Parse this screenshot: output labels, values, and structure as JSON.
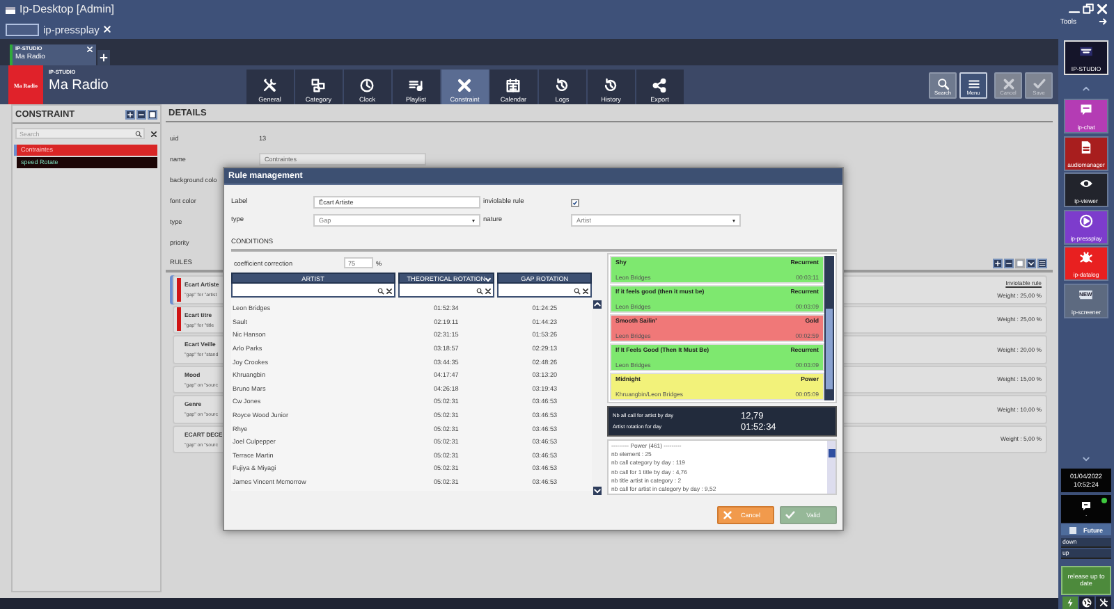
{
  "window": {
    "title": "Ip-Desktop [Admin]",
    "tools_label": "Tools"
  },
  "app_tabs": [
    {
      "label": "ip-pressplay",
      "selected": true
    }
  ],
  "studio_tabs": [
    {
      "product": "IP-STUDIO",
      "label": "Ma Radio",
      "selected": true
    }
  ],
  "header": {
    "logo": "Ma Radio",
    "product": "IP-STUDIO",
    "station": "Ma Radio"
  },
  "toolbar": [
    {
      "label": "General",
      "selected": false
    },
    {
      "label": "Category",
      "selected": false
    },
    {
      "label": "Clock",
      "selected": false
    },
    {
      "label": "Playlist",
      "selected": false
    },
    {
      "label": "Constraint",
      "selected": true
    },
    {
      "label": "Calendar",
      "selected": false
    },
    {
      "label": "Logs",
      "selected": false
    },
    {
      "label": "History",
      "selected": false
    },
    {
      "label": "Export",
      "selected": false
    }
  ],
  "actions": [
    {
      "label": "Search",
      "selected": false,
      "disabled": false
    },
    {
      "label": "Menu",
      "selected": true,
      "disabled": false
    },
    {
      "label": "Cancel",
      "selected": false,
      "disabled": true
    },
    {
      "label": "Save",
      "selected": false,
      "disabled": true
    }
  ],
  "constraint_panel": {
    "title": "CONSTRAINT",
    "search": {
      "placeholder": "Search"
    },
    "items": [
      {
        "label": "Contraintes",
        "color": "#d92626",
        "selected": true
      },
      {
        "label": "speed Rotate",
        "color": "#1c0606",
        "selected": false
      }
    ]
  },
  "details": {
    "title": "DETAILS",
    "fields": [
      {
        "label": "uid",
        "kind": "text",
        "value": "13"
      },
      {
        "label": "name",
        "kind": "input",
        "value": "Contraintes"
      },
      {
        "label": "background colo",
        "kind": "label"
      },
      {
        "label": "font color",
        "kind": "label"
      },
      {
        "label": "type",
        "kind": "label"
      },
      {
        "label": "priority",
        "kind": "label"
      }
    ],
    "rules_title": "RULES",
    "rules": [
      {
        "name": "Ecart Artiste",
        "summary": "\"gap\" for \"artist",
        "note": "Inviolable rule",
        "weight": "Weight : 25,00 %",
        "color": "#d01515",
        "selected": true
      },
      {
        "name": "Ecart titre",
        "summary": "\"gap\" for \"title",
        "weight": "Weight : 25,00 %",
        "color": "#d01515",
        "selected": false
      },
      {
        "name": "Ecart Veille",
        "summary": "\"gap\" for \"stand",
        "weight": "Weight : 20,00 %",
        "selected": false
      },
      {
        "name": "Mood",
        "summary": "\"gap\" on \"sourc",
        "weight": "Weight : 15,00 %",
        "selected": false
      },
      {
        "name": "Genre",
        "summary": "\"gap\" on \"sourc",
        "weight": "Weight : 10,00 %",
        "selected": false
      },
      {
        "name": "ECART DECE",
        "summary": "\"gap\" on \"sourc",
        "weight": "Weight : 5,00 %",
        "selected": false
      }
    ]
  },
  "dialog": {
    "title": "Rule management",
    "label": {
      "label": "Label",
      "value": "Écart Artiste"
    },
    "inviolable": {
      "label": "inviolable rule",
      "checked": true
    },
    "type": {
      "label": "type",
      "value": "Gap"
    },
    "nature": {
      "label": "nature",
      "value": "Artist"
    },
    "conditions_title": "CONDITIONS",
    "coefficient": {
      "label": "coefficient correction",
      "value": "75",
      "unit": "%"
    },
    "columns": [
      "ARTIST",
      "THEORETICAL ROTATION",
      "GAP ROTATION"
    ],
    "rows": [
      [
        "Leon Bridges",
        "01:52:34",
        "01:24:25"
      ],
      [
        "Sault",
        "02:19:11",
        "01:44:23"
      ],
      [
        "Nic Hanson",
        "02:31:15",
        "01:53:26"
      ],
      [
        "Arlo Parks",
        "03:18:57",
        "02:29:13"
      ],
      [
        "Joy Crookes",
        "03:44:35",
        "02:48:26"
      ],
      [
        "Khruangbin",
        "04:17:47",
        "03:13:20"
      ],
      [
        "Bruno Mars",
        "04:26:18",
        "03:19:43"
      ],
      [
        "Cw Jones",
        "05:02:31",
        "03:46:53"
      ],
      [
        "Royce Wood Junior",
        "05:02:31",
        "03:46:53"
      ],
      [
        "Rhye",
        "05:02:31",
        "03:46:53"
      ],
      [
        "Joel Culpepper",
        "05:02:31",
        "03:46:53"
      ],
      [
        "Terrace Martin",
        "05:02:31",
        "03:46:53"
      ],
      [
        "Fujiya & Miyagi",
        "05:02:31",
        "03:46:53"
      ],
      [
        "James Vincent Mcmorrow",
        "05:02:31",
        "03:46:53"
      ]
    ],
    "songs": [
      {
        "title": "Shy",
        "category": "Recurrent",
        "artist": "Leon Bridges",
        "duration": "00:03:11",
        "color": "#7ee86f"
      },
      {
        "title": "If it feels good (then it must be)",
        "category": "Recurrent",
        "artist": "Leon Bridges",
        "duration": "00:03:09",
        "color": "#7ee86f"
      },
      {
        "title": "Smooth Sailin'",
        "category": "Gold",
        "artist": "Leon Bridges",
        "duration": "00:02:59",
        "color": "#f07878"
      },
      {
        "title": "If It Feels Good (Then It Must Be)",
        "category": "Recurrent",
        "artist": "Leon Bridges",
        "duration": "00:03:09",
        "color": "#7ee86f"
      },
      {
        "title": "Midnight",
        "category": "Power",
        "artist": "Khruangbin/Leon Bridges",
        "duration": "00:05:09",
        "color": "#f2f27a"
      }
    ],
    "stats": [
      {
        "label": "Nb all call for artist by day",
        "value": "12,79"
      },
      {
        "label": "Artist rotation for day",
        "value": "01:52:34"
      }
    ],
    "log": [
      "--------- Power (461) ---------",
      "nb element : 25",
      "nb call category by day : 119",
      "nb call for 1 title by day : 4,76",
      "nb title artist in category : 2",
      "nb call for artist in category by day : 9,52"
    ],
    "buttons": [
      {
        "label": "Cancel",
        "kind": "cancel",
        "disabled": false
      },
      {
        "label": "Valid",
        "kind": "valid",
        "disabled": true
      }
    ]
  },
  "sidebar": {
    "tiles": [
      {
        "label": "IP-STUDIO",
        "color": "#15152a"
      },
      {
        "label": "ip-chat",
        "color": "#b43cb4"
      },
      {
        "label": "audiomanager",
        "color": "#a81e1e"
      },
      {
        "label": "ip-viewer",
        "color": "#22242c"
      },
      {
        "label": "ip-pressplay",
        "color": "#7d3ccc"
      },
      {
        "label": "ip-datalog",
        "color": "#e82020"
      },
      {
        "label": "ip-screener",
        "badge": "NEW",
        "color": "#5d6a80"
      }
    ],
    "date": "01/04/2022",
    "time": "10:52:24",
    "online": true,
    "status_text": ".",
    "future": "Future",
    "lines": [
      "down",
      "up"
    ],
    "release": "release up to date"
  }
}
